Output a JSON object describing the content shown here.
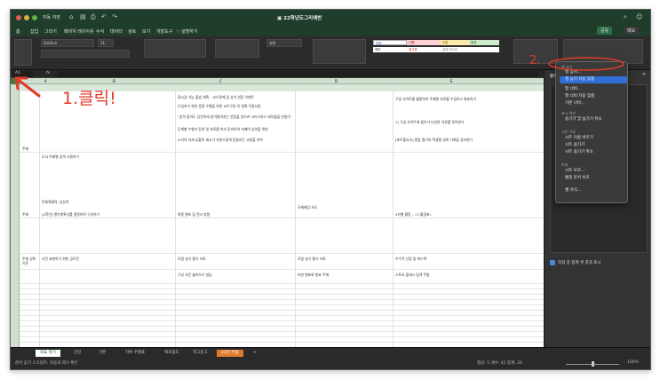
{
  "window": {
    "title": "▣ 22학년도그리에번",
    "autosave": "자동 저장"
  },
  "menu": [
    "홈",
    "삽입",
    "그리기",
    "페이지 레이아웃",
    "수식",
    "데이터",
    "검토",
    "보기",
    "개발도구",
    "♡ 설명하기"
  ],
  "toolbar": {
    "font": "SimSun",
    "size": "11",
    "share": "공유",
    "comment": "메모",
    "format": "일반"
  },
  "styles": [
    "표준",
    "나쁨",
    "보통",
    "좋음",
    "메모",
    "경고문",
    "설명 텍스트"
  ],
  "namebox": "A1",
  "columns": [
    "A",
    "B",
    "C",
    "D",
    "E"
  ],
  "cells": {
    "c1": "광시권 기능 출범 계획 – 교우관계 및 상가 연장 이벤트",
    "c2": "수입하기 위한 응용 수행을 위한 교우구류 의 영륙 이류자류",
    "c3": "“흔히 들어도 당연하게 받아들여지는 반응을 일으켜 크리스마스 테이블을 만들어",
    "c4": "단계별 수행과 탐색 및 자료를 미리 준비하여 저매여 상연을 위한",
    "c5": "노지의 자세 상황의 제시가 자연스럽게 흔들리는 교원을 하여",
    "e1": "구글 사이트를 활용하여 주제별 자료를 수집하고 발표하기",
    "e2": "1) 구글 사이트에 들어가 다양한 자료를 찾아본다",
    "e3": "[포트폴리오] 종합 평가와 학생별 성취 기록을 정리한다",
    "rowlabel1": "주제",
    "rowlabel2": "주제",
    "rowlabel3": "주제 성취기준",
    "b3": "도서 주제별 검색 사용하기",
    "b4": "문제해결력, 상상력",
    "b5": "[4학년] 평가계획서를 결정하여 구성하기",
    "b6": "사진 표현하기 위한 공모전",
    "c6": "최종 발표 및 전시 방법",
    "d6": "모범 실기 평가 자료",
    "e6": "우수작 선정 및 피드백",
    "c7": "구성 사진 불러오기 실습",
    "d7": "보완 발표회 발표 주제",
    "e7": "스토리 플래시 탐색 주범",
    "d5": "국제배당 지도",
    "e5": "4자별 활동 – «3 홀경표»"
  },
  "context_menu": {
    "items": [
      "행 높이...",
      "행 높이 자동 맞춤",
      "열 너비...",
      "열 너비 자동 맞춤",
      "기본 너비...",
      "숨기기 및 숨기기 취소",
      "시트 이름 바꾸기",
      "시트 숨기기",
      "시트 숨기기 취소",
      "보호",
      "시트 보호...",
      "통합 문서 보호",
      "셀 서식..."
    ],
    "sections": [
      "셀 크기",
      "표시 여부",
      "시트 구성",
      "보호"
    ]
  },
  "pane": {
    "title": "분석",
    "option": "작업 중 합계 셋 결과 표시"
  },
  "sheets": [
    "최슠 평가",
    "건강",
    "기본",
    "하루 수행표",
    "택호업도",
    "학그운그",
    "22년 수업",
    "+"
  ],
  "status": {
    "left": "준비  듣기 스크립트: 작동의 제거 확인",
    "stats": "평균: 5   개수: 41   합계: 20",
    "zoom": "100%"
  },
  "annotations": {
    "step1": "1.클릭!",
    "step2": "2."
  }
}
